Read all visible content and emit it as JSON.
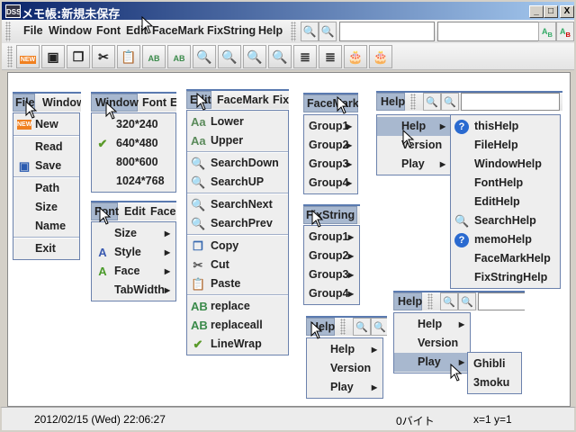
{
  "window": {
    "title": "メモ帳:新規未保存",
    "app_icon": "DSS",
    "minimize": "_",
    "maximize": "□",
    "close": "X"
  },
  "menubar": {
    "items": [
      "File",
      "Window",
      "Font",
      "Edit",
      "FaceMark",
      "FixString",
      "Help"
    ]
  },
  "search": {
    "find_value": "",
    "replace_value": ""
  },
  "toolbar": {
    "icons": [
      "new-icon",
      "save-icon",
      "copy-icon",
      "cut-icon",
      "paste-icon",
      "replace-icon",
      "replace-all-icon",
      "search-down-icon",
      "search-up-icon",
      "search-next-icon",
      "search-prev-icon",
      "indent-icon",
      "unindent-icon",
      "cake-icon",
      "cake-icon"
    ]
  },
  "menus": {
    "file": {
      "strip": [
        "File",
        "Window"
      ],
      "items": [
        {
          "label": "New",
          "icon": "new"
        },
        "-",
        {
          "label": "Read"
        },
        {
          "label": "Save",
          "icon": "save"
        },
        "-",
        {
          "label": "Path"
        },
        {
          "label": "Size"
        },
        {
          "label": "Name"
        },
        "-",
        {
          "label": "Exit"
        }
      ]
    },
    "window": {
      "strip": [
        "Window",
        "Font",
        "E"
      ],
      "items": [
        {
          "label": "320*240"
        },
        {
          "label": "640*480",
          "icon": "check"
        },
        {
          "label": "800*600"
        },
        {
          "label": "1024*768"
        }
      ]
    },
    "font": {
      "strip": [
        "Font",
        "Edit",
        "FaceI"
      ],
      "items": [
        {
          "label": "Size",
          "sub": true
        },
        {
          "label": "Style",
          "icon": "style",
          "sub": true
        },
        {
          "label": "Face",
          "icon": "face",
          "sub": true
        },
        {
          "label": "TabWidth",
          "sub": true
        }
      ]
    },
    "edit": {
      "strip": [
        "Edit",
        "FaceMark",
        "Fix"
      ],
      "items": [
        {
          "label": "Lower",
          "icon": "lower"
        },
        {
          "label": "Upper",
          "icon": "upper"
        },
        "-",
        {
          "label": "SearchDown",
          "icon": "search"
        },
        {
          "label": "SearchUP",
          "icon": "search"
        },
        "-",
        {
          "label": "SearchNext",
          "icon": "search"
        },
        {
          "label": "SearchPrev",
          "icon": "search"
        },
        "-",
        {
          "label": "Copy",
          "icon": "copy"
        },
        {
          "label": "Cut",
          "icon": "cut"
        },
        {
          "label": "Paste",
          "icon": "paste"
        },
        "-",
        {
          "label": "replace",
          "icon": "replace"
        },
        {
          "label": "replaceall",
          "icon": "replace"
        },
        {
          "label": "LineWrap",
          "icon": "check"
        }
      ]
    },
    "facemark": {
      "strip": [
        "FaceMark"
      ],
      "items": [
        {
          "label": "Group1",
          "sub": true
        },
        {
          "label": "Group2",
          "sub": true
        },
        {
          "label": "Group3",
          "sub": true
        },
        {
          "label": "Group4",
          "sub": true
        }
      ]
    },
    "fixstring": {
      "strip": [
        "FixString"
      ],
      "items": [
        {
          "label": "Group1",
          "sub": true
        },
        {
          "label": "Group2",
          "sub": true
        },
        {
          "label": "Group3",
          "sub": true
        },
        {
          "label": "Group4",
          "sub": true
        }
      ]
    },
    "help1": {
      "strip": [
        "Help"
      ],
      "items": [
        {
          "label": "Help",
          "sub": true,
          "selected": true
        },
        {
          "label": "Version"
        },
        {
          "label": "Play",
          "sub": true
        }
      ]
    },
    "help1_sub": {
      "items": [
        {
          "label": "thisHelp",
          "icon": "help"
        },
        {
          "label": "FileHelp"
        },
        {
          "label": "WindowHelp"
        },
        {
          "label": "FontHelp"
        },
        {
          "label": "EditHelp"
        },
        {
          "label": "SearchHelp",
          "icon": "search"
        },
        {
          "label": "memoHelp",
          "icon": "help"
        },
        {
          "label": "FaceMarkHelp"
        },
        {
          "label": "FixStringHelp"
        }
      ]
    },
    "help2": {
      "strip": [
        "Help"
      ],
      "items": [
        {
          "label": "Help",
          "sub": true
        },
        {
          "label": "Version"
        },
        {
          "label": "Play",
          "sub": true
        }
      ]
    },
    "help3": {
      "strip": [
        "Help"
      ],
      "items": [
        {
          "label": "Help",
          "sub": true
        },
        {
          "label": "Version"
        },
        {
          "label": "Play",
          "sub": true,
          "selected": true
        }
      ]
    },
    "help3_sub": {
      "items": [
        {
          "label": "Ghibli"
        },
        {
          "label": "3moku"
        }
      ]
    }
  },
  "status": {
    "datetime": "2012/02/15 (Wed) 22:06:27",
    "size": "0バイト",
    "position": "x=1 y=1"
  }
}
